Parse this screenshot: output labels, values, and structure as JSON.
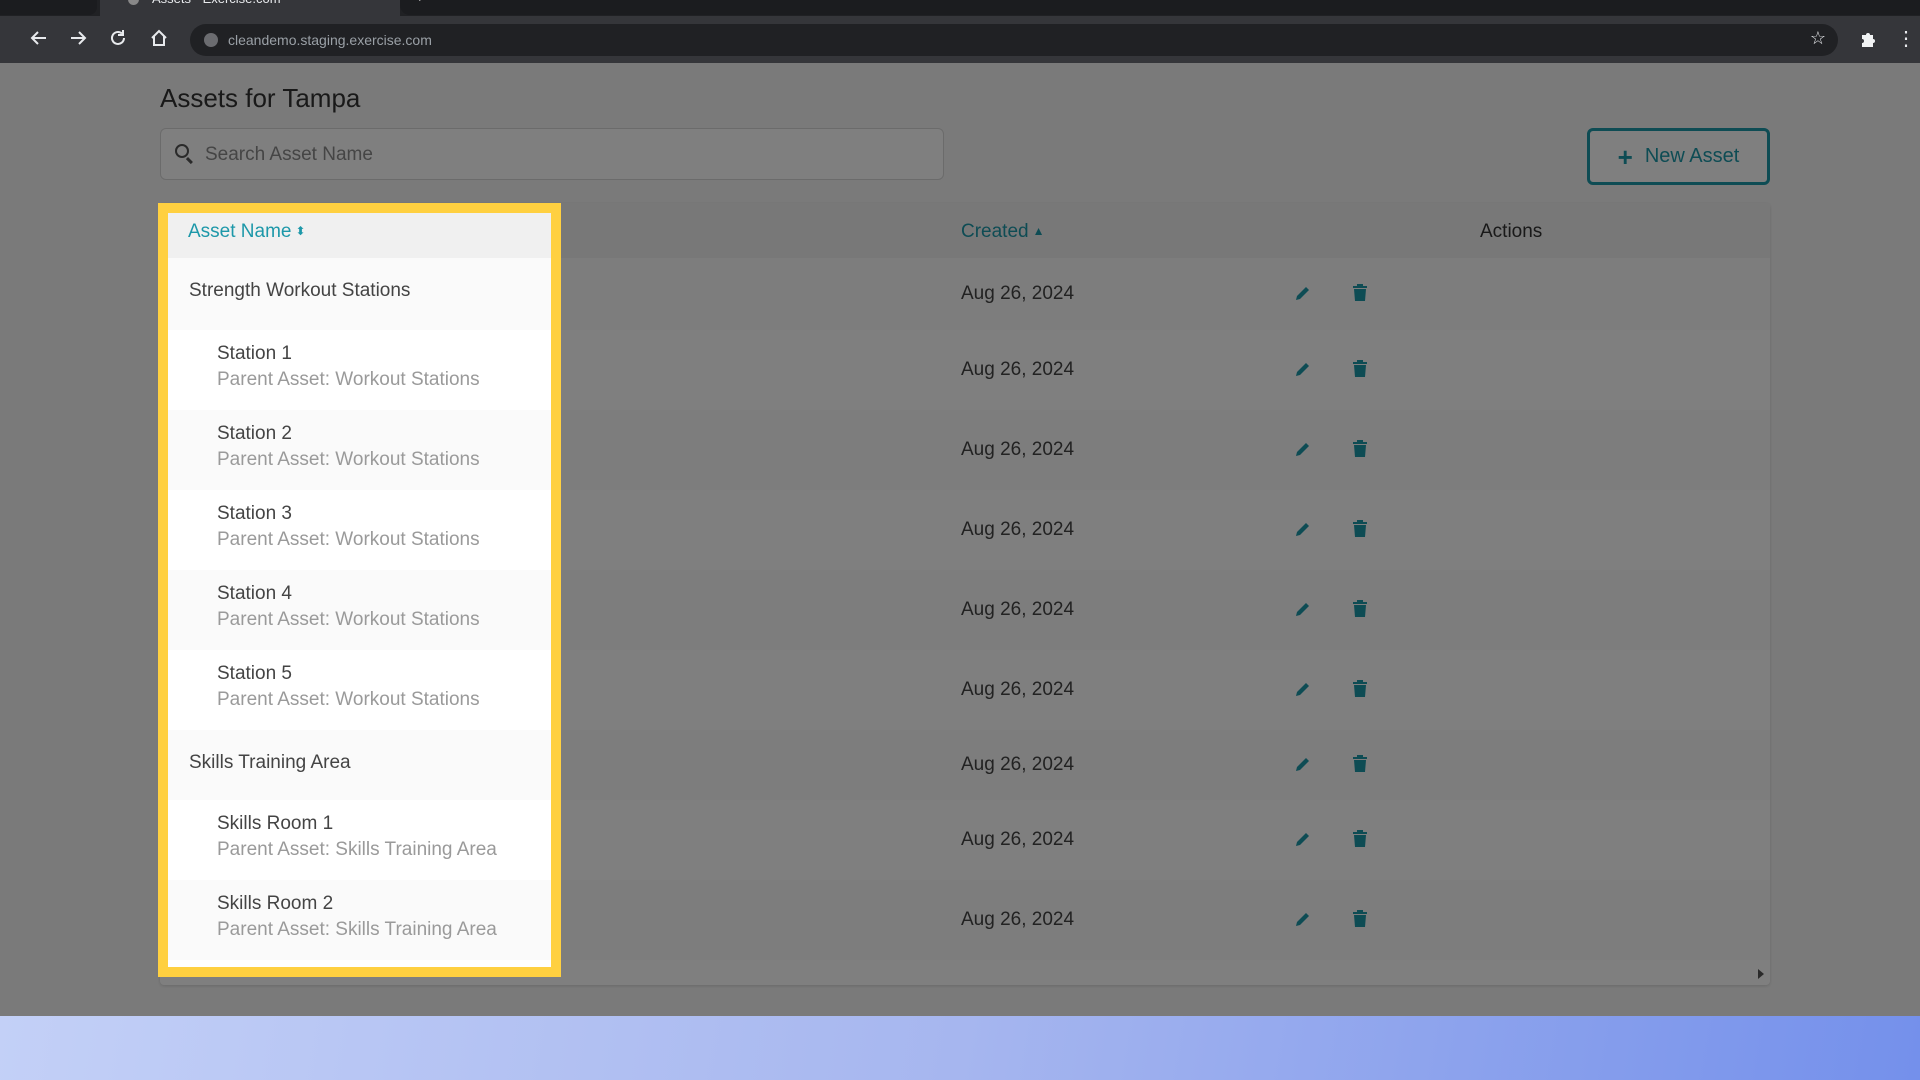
{
  "browser": {
    "tab_title": "Assets - Exercise.com",
    "url": "cleandemo.staging.exercise.com",
    "icons": {
      "back": "arrow-left-icon",
      "forward": "arrow-right-icon",
      "reload": "reload-icon",
      "home": "home-icon",
      "site_info": "globe-icon",
      "bookmark": "star-icon",
      "extensions": "puzzle-icon",
      "menu": "kebab-menu-icon"
    }
  },
  "page": {
    "title": "Assets for Tampa",
    "search": {
      "placeholder": "Search Asset Name",
      "value": ""
    },
    "new_asset_label": "New Asset"
  },
  "table": {
    "columns": {
      "name": "Asset Name",
      "created": "Created",
      "actions": "Actions"
    },
    "sort": {
      "name": "both",
      "created": "ascending"
    },
    "rows": [
      {
        "name": "Strength Workout Stations",
        "parent": "",
        "created": "Aug 26, 2024"
      },
      {
        "name": "Station 1",
        "parent": "Parent Asset: Workout Stations",
        "created": "Aug 26, 2024"
      },
      {
        "name": "Station 2",
        "parent": "Parent Asset: Workout Stations",
        "created": "Aug 26, 2024"
      },
      {
        "name": "Station 3",
        "parent": "Parent Asset: Workout Stations",
        "created": "Aug 26, 2024"
      },
      {
        "name": "Station 4",
        "parent": "Parent Asset: Workout Stations",
        "created": "Aug 26, 2024"
      },
      {
        "name": "Station 5",
        "parent": "Parent Asset: Workout Stations",
        "created": "Aug 26, 2024"
      },
      {
        "name": "Skills Training Area",
        "parent": "",
        "created": "Aug 26, 2024"
      },
      {
        "name": "Skills Room 1",
        "parent": "Parent Asset: Skills Training Area",
        "created": "Aug 26, 2024"
      },
      {
        "name": "Skills Room 2",
        "parent": "Parent Asset: Skills Training Area",
        "created": "Aug 26, 2024"
      }
    ]
  },
  "colors": {
    "accent": "#1d98a9",
    "highlight": "#ffd040",
    "overlay": "rgba(0,0,0,0.5)"
  }
}
